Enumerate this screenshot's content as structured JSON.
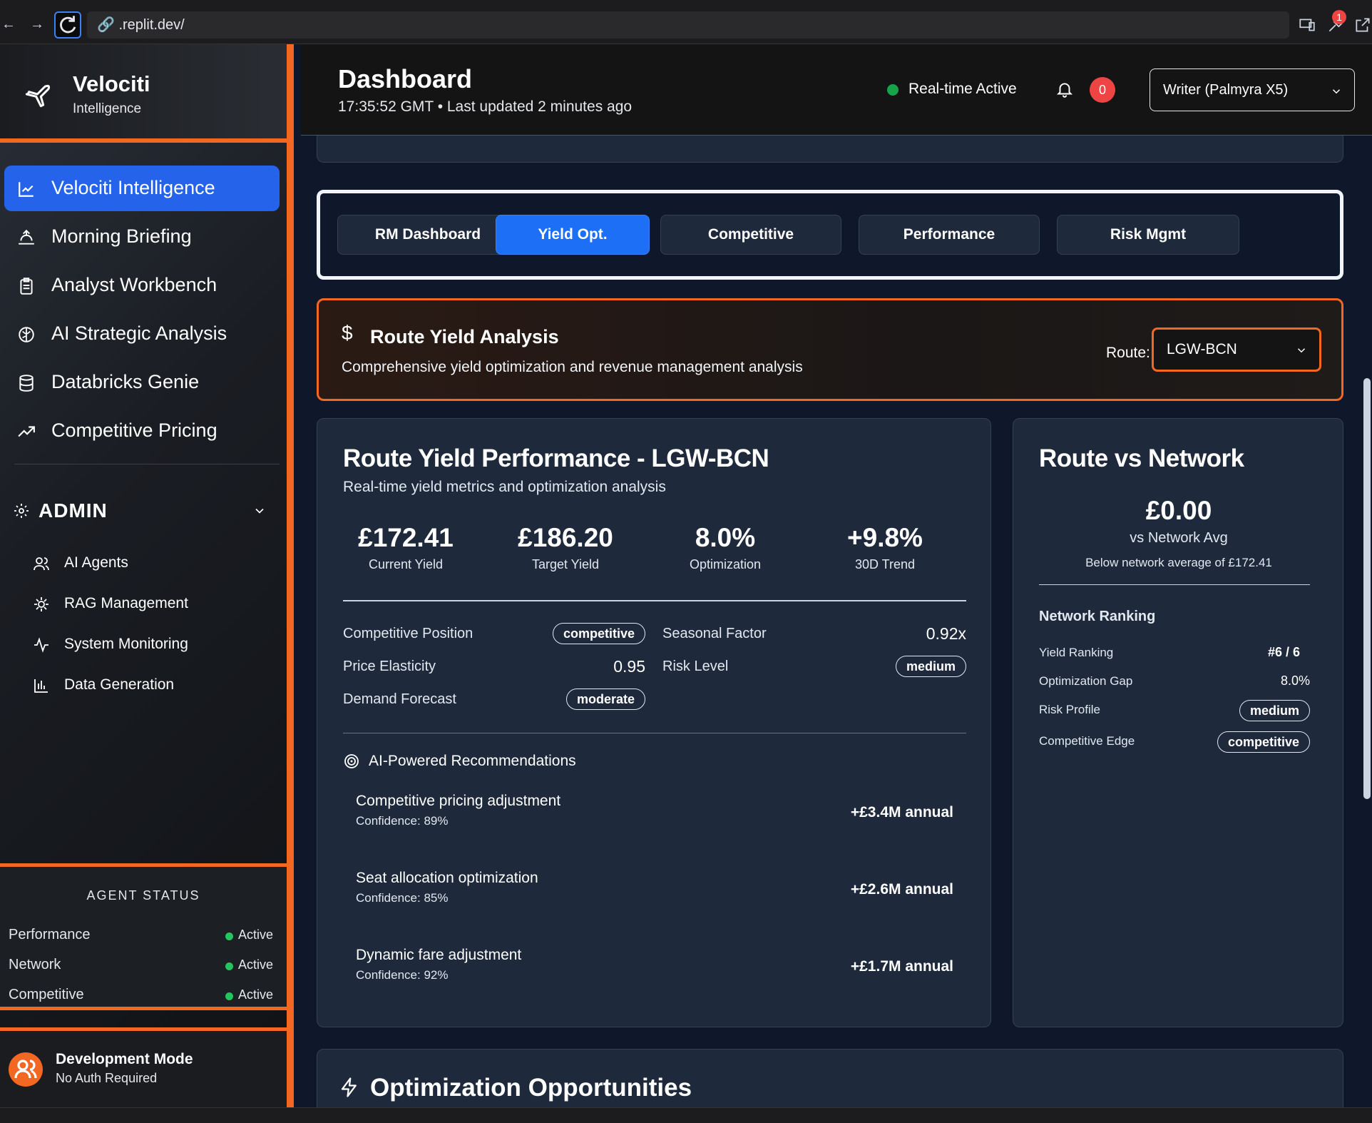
{
  "browser": {
    "url": ".replit.dev/",
    "notification_count": "1"
  },
  "brand": {
    "name": "Velociti",
    "tagline": "Intelligence"
  },
  "nav": {
    "items": [
      {
        "label": "Velociti Intelligence",
        "icon": "line-chart-icon",
        "active": true
      },
      {
        "label": "Morning Briefing",
        "icon": "sunrise-icon",
        "active": false
      },
      {
        "label": "Analyst Workbench",
        "icon": "clipboard-icon",
        "active": false
      },
      {
        "label": "AI Strategic Analysis",
        "icon": "brain-icon",
        "active": false
      },
      {
        "label": "Databricks Genie",
        "icon": "database-icon",
        "active": false
      },
      {
        "label": "Competitive Pricing",
        "icon": "trending-up-icon",
        "active": false
      }
    ],
    "admin": {
      "label": "ADMIN",
      "items": [
        {
          "label": "AI Agents",
          "icon": "users-icon"
        },
        {
          "label": "RAG Management",
          "icon": "cog-icon"
        },
        {
          "label": "System Monitoring",
          "icon": "activity-icon"
        },
        {
          "label": "Data Generation",
          "icon": "bar-chart-icon"
        }
      ]
    }
  },
  "agent_status": {
    "title": "AGENT STATUS",
    "rows": [
      {
        "name": "Performance",
        "status": "Active"
      },
      {
        "name": "Network",
        "status": "Active"
      },
      {
        "name": "Competitive",
        "status": "Active"
      }
    ]
  },
  "dev": {
    "title": "Development Mode",
    "subtitle": "No Auth Required"
  },
  "header": {
    "title": "Dashboard",
    "subtitle": "17:35:52 GMT • Last updated 2 minutes ago",
    "realtime": "Real-time Active",
    "notif_count": "0",
    "model": "Writer (Palmyra X5)"
  },
  "tabs": [
    {
      "label": "RM Dashboard",
      "selected": false
    },
    {
      "label": "Yield Opt.",
      "selected": true
    },
    {
      "label": "Competitive",
      "selected": false
    },
    {
      "label": "Performance",
      "selected": false
    },
    {
      "label": "Risk Mgmt",
      "selected": false
    }
  ],
  "yield_header": {
    "title": "Route Yield Analysis",
    "desc": "Comprehensive yield optimization and revenue management analysis",
    "route_label": "Route:",
    "route_value": "LGW-BCN"
  },
  "performance": {
    "title": "Route Yield Performance - LGW-BCN",
    "subtitle": "Real-time yield metrics and optimization analysis",
    "metrics": [
      {
        "value": "£172.41",
        "label": "Current Yield"
      },
      {
        "value": "£186.20",
        "label": "Target Yield"
      },
      {
        "value": "8.0%",
        "label": "Optimization"
      },
      {
        "value": "+9.8%",
        "label": "30D Trend"
      }
    ],
    "left_kv": [
      {
        "key": "Competitive Position",
        "pill": "competitive"
      },
      {
        "key": "Price Elasticity",
        "value": "0.95"
      },
      {
        "key": "Demand Forecast",
        "pill": "moderate"
      }
    ],
    "right_kv": [
      {
        "key": "Seasonal Factor",
        "value": "0.92x"
      },
      {
        "key": "Risk Level",
        "pill": "medium"
      }
    ],
    "recs_title": "AI-Powered Recommendations",
    "recs": [
      {
        "title": "Competitive pricing adjustment",
        "confidence": "Confidence: 89%",
        "impact": "+£3.4M annual"
      },
      {
        "title": "Seat allocation optimization",
        "confidence": "Confidence: 85%",
        "impact": "+£2.6M annual"
      },
      {
        "title": "Dynamic fare adjustment",
        "confidence": "Confidence: 92%",
        "impact": "+£1.7M annual"
      }
    ]
  },
  "network": {
    "title": "Route vs Network",
    "diff": "£0.00",
    "vs": "vs Network Avg",
    "note": "Below network average of £172.41",
    "ranking_title": "Network Ranking",
    "rows": [
      {
        "key": "Yield Ranking",
        "value": "#6 / 6"
      },
      {
        "key": "Optimization Gap",
        "value": "8.0%"
      },
      {
        "key": "Risk Profile",
        "pill": "medium"
      },
      {
        "key": "Competitive Edge",
        "pill": "competitive"
      }
    ]
  },
  "optimization": {
    "title": "Optimization Opportunities"
  },
  "colors": {
    "accent": "#f26722",
    "primary": "#2563eb",
    "active": "#22c55e",
    "alert": "#ef4444"
  }
}
